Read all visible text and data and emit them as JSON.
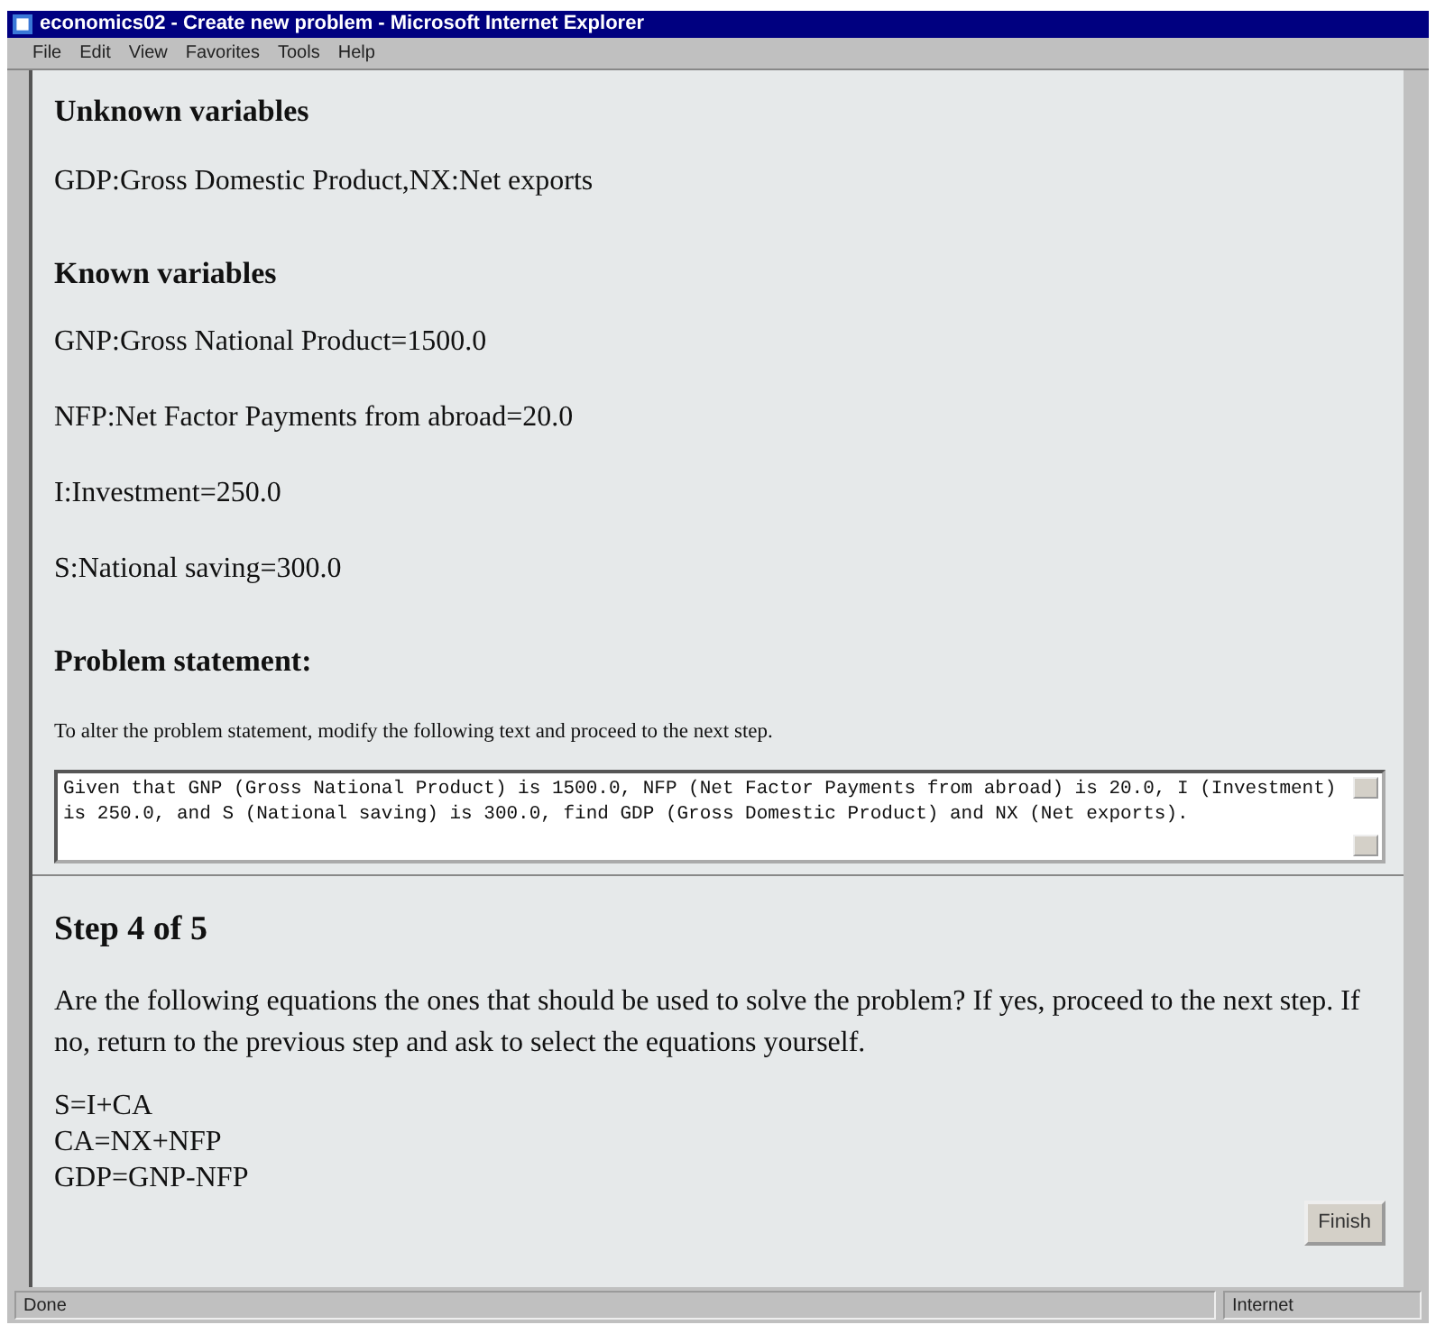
{
  "window": {
    "title": "economics02 - Create new problem - Microsoft Internet Explorer"
  },
  "menu": [
    "File",
    "Edit",
    "View",
    "Favorites",
    "Tools",
    "Help"
  ],
  "sections": [
    {
      "heading": "Unknown variables",
      "lines": [
        "GDP:Gross Domestic Product,NX:Net exports"
      ]
    },
    {
      "heading": "Known variables",
      "lines": [
        "GNP:Gross National Product=1500.0",
        "NFP:Net Factor Payments from abroad=20.0",
        "I:Investment=250.0",
        "S:National saving=300.0"
      ]
    }
  ],
  "problem": {
    "heading": "Problem statement:",
    "instruction": "To alter the problem statement, modify the following text and proceed to the next step.",
    "text": "Given that GNP (Gross National Product) is 1500.0, NFP (Net Factor Payments from abroad) is 20.0, I (Investment) is 250.0, and S (National saving) is 300.0, find GDP (Gross Domestic Product) and NX (Net exports)."
  },
  "step": {
    "title": "Step 4 of 5",
    "question": "Are the following equations the ones that should be used to solve the problem? If yes, proceed to the next step. If no, return to the previous step and ask to select the equations yourself.",
    "equations": [
      "S=I+CA",
      "CA=NX+NFP",
      "GDP=GNP-NFP"
    ],
    "button": "Finish"
  },
  "status_bar": {
    "text": "Done",
    "zone": "Internet"
  }
}
